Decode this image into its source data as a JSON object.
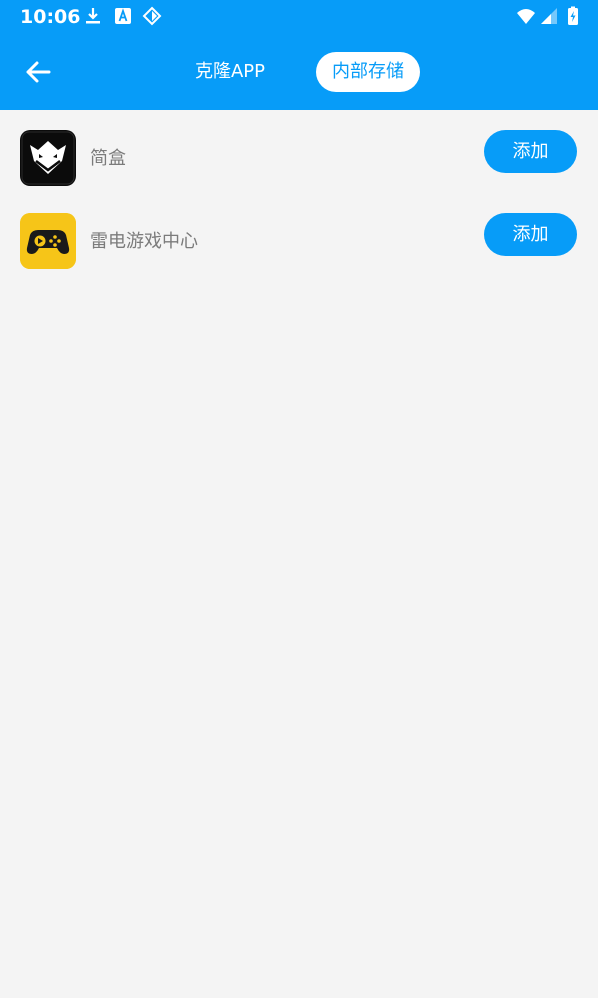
{
  "status_bar": {
    "time": "10:06",
    "left_icons": [
      "download-icon",
      "a-square-icon",
      "tag-icon"
    ],
    "right_icons": [
      "wifi-icon",
      "signal-icon",
      "battery-icon"
    ]
  },
  "header": {
    "back_icon": "arrow-left-icon",
    "tabs": [
      {
        "label": "克隆APP",
        "active": false
      },
      {
        "label": "内部存储",
        "active": true
      }
    ],
    "accent_color": "#079cf8"
  },
  "apps": [
    {
      "name": "简盒",
      "icon": "jianhe-app-icon",
      "button_label": "添加"
    },
    {
      "name": "雷电游戏中心",
      "icon": "gamepad-app-icon",
      "button_label": "添加"
    }
  ]
}
